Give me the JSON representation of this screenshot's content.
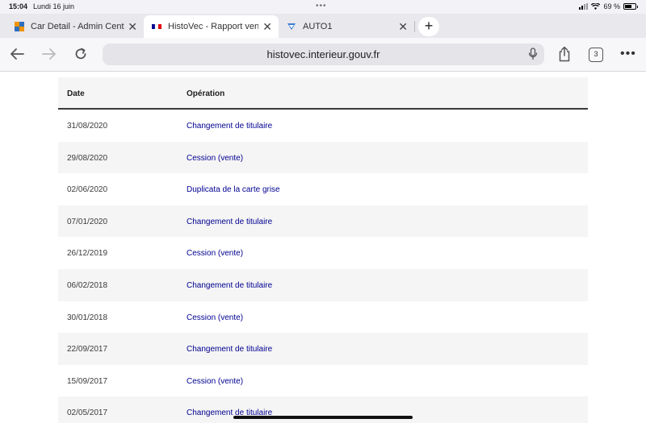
{
  "status_bar": {
    "time": "15:04",
    "date": "Lundi 16 juin",
    "battery": "69 %"
  },
  "tabs": [
    {
      "title": "Car Detail - Admin Cente",
      "icon": "grid-favicon-icon"
    },
    {
      "title": "HistoVec - Rapport vend",
      "icon": "french-flag-icon"
    },
    {
      "title": "AUTO1",
      "icon": "auto1-favicon-icon"
    }
  ],
  "toolbar": {
    "url": "histovec.interieur.gouv.fr",
    "tab_count": "3"
  },
  "table": {
    "headers": {
      "date": "Date",
      "operation": "Opération"
    },
    "rows": [
      {
        "date": "31/08/2020",
        "operation": "Changement de titulaire"
      },
      {
        "date": "29/08/2020",
        "operation": "Cession (vente)"
      },
      {
        "date": "02/06/2020",
        "operation": "Duplicata de la carte grise"
      },
      {
        "date": "07/01/2020",
        "operation": "Changement de titulaire"
      },
      {
        "date": "26/12/2019",
        "operation": "Cession (vente)"
      },
      {
        "date": "06/02/2018",
        "operation": "Changement de titulaire"
      },
      {
        "date": "30/01/2018",
        "operation": "Cession (vente)"
      },
      {
        "date": "22/09/2017",
        "operation": "Changement de titulaire"
      },
      {
        "date": "15/09/2017",
        "operation": "Cession (vente)"
      },
      {
        "date": "02/05/2017",
        "operation": "Changement de titulaire"
      }
    ]
  }
}
